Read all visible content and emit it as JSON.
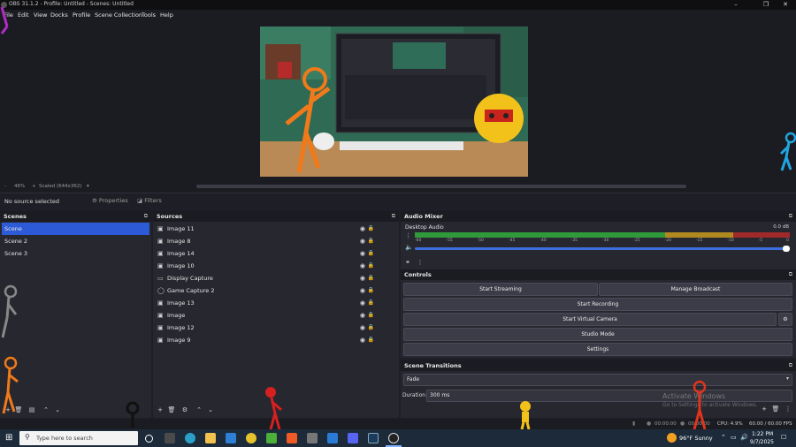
{
  "window": {
    "title": "OBS 31.1.2 - Profile: Untitled - Scenes: Untitled"
  },
  "menu": [
    "File",
    "Edit",
    "View",
    "Docks",
    "Profile",
    "Scene Collection",
    "Tools",
    "Help"
  ],
  "zoom": {
    "minus": "-",
    "value": "46%",
    "plus": "+",
    "mode": "Scaled (644x362)",
    "dropdown": "▾"
  },
  "context": {
    "no_source": "No source selected",
    "properties": "Properties",
    "filters": "Filters"
  },
  "scenes": {
    "title": "Scenes",
    "items": [
      "Scene",
      "Scene 2",
      "Scene 3"
    ],
    "selected": 0
  },
  "sources": {
    "title": "Sources",
    "items": [
      {
        "label": "Image 11",
        "icon": "image-icon"
      },
      {
        "label": "Image 8",
        "icon": "image-icon"
      },
      {
        "label": "Image 14",
        "icon": "image-icon"
      },
      {
        "label": "Image 10",
        "icon": "image-icon"
      },
      {
        "label": "Display Capture",
        "icon": "monitor-icon"
      },
      {
        "label": "Game Capture 2",
        "icon": "gamepad-icon"
      },
      {
        "label": "Image 13",
        "icon": "image-icon"
      },
      {
        "label": "Image",
        "icon": "image-icon"
      },
      {
        "label": "Image 12",
        "icon": "image-icon"
      },
      {
        "label": "Image 9",
        "icon": "image-icon"
      }
    ]
  },
  "mixer": {
    "title": "Audio Mixer",
    "track": "Desktop Audio",
    "level": "0.0 dB",
    "scale": [
      "-60",
      "-55",
      "-50",
      "-45",
      "-40",
      "-35",
      "-30",
      "-25",
      "-20",
      "-15",
      "-10",
      "-5",
      "0"
    ],
    "volume": 1.0
  },
  "controls": {
    "title": "Controls",
    "start_streaming": "Start Streaming",
    "manage_broadcast": "Manage Broadcast",
    "start_recording": "Start Recording",
    "start_virtual_camera": "Start Virtual Camera",
    "studio_mode": "Studio Mode",
    "settings": "Settings"
  },
  "transitions": {
    "title": "Scene Transitions",
    "type": "Fade",
    "duration_label": "Duration",
    "duration_value": "300 ms"
  },
  "statusbar": {
    "stream_time": "00:00:00",
    "rec_time": "00:00:00",
    "cpu": "CPU: 4.9%",
    "fps": "60.00 / 60.00 FPS"
  },
  "watermark": {
    "line1": "Activate Windows",
    "line2": "Go to Settings to activate Windows."
  },
  "taskbar": {
    "search_placeholder": "Type here to search",
    "weather": "96°F  Sunny",
    "time": "1:22 PM",
    "date": "9/7/2025"
  },
  "colors": {
    "accent": "#2d5ad6",
    "meter_green": "#2f9a3a",
    "meter_yellow": "#b08a1f",
    "meter_red": "#a02a2a",
    "volume_blue": "#3d6fe0"
  }
}
